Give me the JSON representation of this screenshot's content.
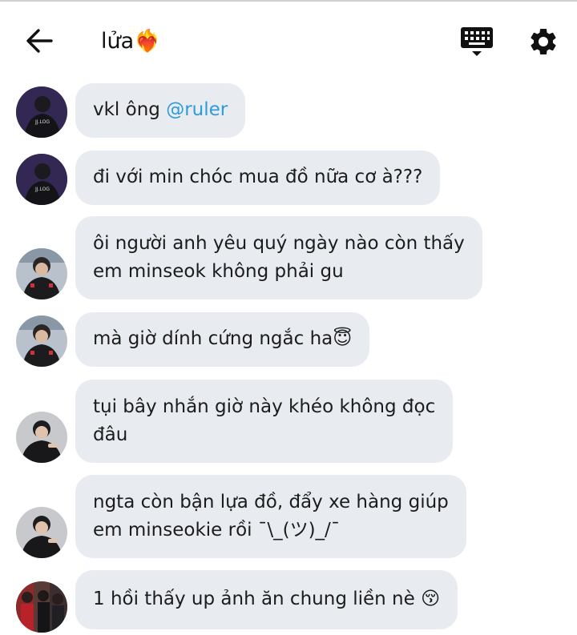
{
  "header": {
    "title": "lửa❤️‍🔥",
    "icons": {
      "back": "arrow-left-icon",
      "keyboard": "keyboard-icon",
      "settings": "gear-icon"
    }
  },
  "messages": [
    {
      "avatar": "avatar-user-a",
      "lines": [
        "vkl ông "
      ],
      "mention": "@ruler"
    },
    {
      "avatar": "avatar-user-a",
      "lines": [
        "đi với min chóc mua đồ nữa cơ à???"
      ]
    },
    {
      "avatar": "avatar-user-b",
      "lines": [
        "ôi người anh yêu quý ngày nào còn thấy",
        "em minseok không phải gu"
      ]
    },
    {
      "avatar": "avatar-user-b",
      "lines": [
        "mà giờ dính cứng ngắc ha😇"
      ]
    },
    {
      "avatar": "avatar-user-c",
      "lines": [
        "tụi bây nhắn giờ này khéo không đọc",
        "đâu"
      ]
    },
    {
      "avatar": "avatar-user-c",
      "lines": [
        "ngta còn bận lựa đồ, đẩy xe hàng giúp",
        "em minseokie rồi ¯\\_(ツ)_/¯"
      ]
    },
    {
      "avatar": "avatar-user-d",
      "lines": [
        "1 hồi thấy up ảnh ăn chung liền nè 😚"
      ]
    }
  ],
  "colors": {
    "bubble": "#e8ebf0",
    "mention": "#2f9bd9",
    "text": "#1c1c1c"
  }
}
